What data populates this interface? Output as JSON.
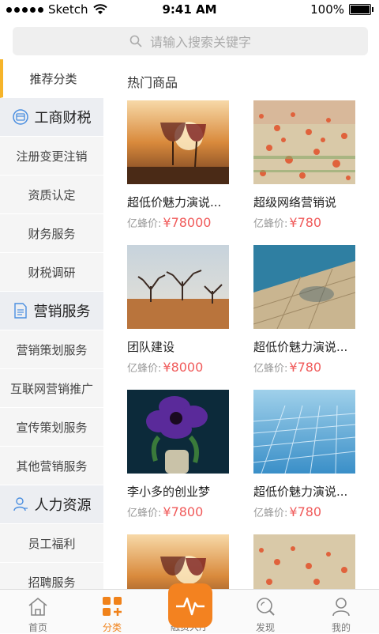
{
  "status_bar": {
    "carrier": "Sketch",
    "time": "9:41 AM",
    "battery": "100%"
  },
  "search": {
    "placeholder": "请输入搜索关键字"
  },
  "sidebar": {
    "recommend": "推荐分类",
    "groups": [
      {
        "title": "工商财税",
        "icon": "tax-icon",
        "items": [
          "注册变更注销",
          "资质认定",
          "财务服务",
          "财税调研"
        ]
      },
      {
        "title": "营销服务",
        "icon": "document-icon",
        "items": [
          "营销策划服务",
          "互联网营销推广",
          "宣传策划服务",
          "其他营销服务"
        ]
      },
      {
        "title": "人力资源",
        "icon": "person-icon",
        "items": [
          "员工福利",
          "招聘服务"
        ]
      }
    ]
  },
  "main": {
    "title": "热门商品",
    "price_label": "亿蜂价:",
    "products": [
      {
        "name": "超低价魅力演说...",
        "price": "¥78000",
        "image": "wine-glasses"
      },
      {
        "name": "超级网络营销说",
        "price": "¥780",
        "image": "flower-field"
      },
      {
        "name": "团队建设",
        "price": "¥8000",
        "image": "trees-landscape"
      },
      {
        "name": "超低价魅力演说...",
        "price": "¥780",
        "image": "water-pool"
      },
      {
        "name": "李小多的创业梦",
        "price": "¥7800",
        "image": "purple-flower"
      },
      {
        "name": "超低价魅力演说...",
        "price": "¥780",
        "image": "blue-tiles"
      },
      {
        "name": "",
        "price": "",
        "image": "wine-glasses"
      },
      {
        "name": "",
        "price": "",
        "image": "flower-field"
      }
    ]
  },
  "tabbar": {
    "home": "首页",
    "category": "分类",
    "finance": "融资大厅",
    "discover": "发现",
    "mine": "我的"
  },
  "colors": {
    "accent": "#f38220",
    "price": "#f05a5a",
    "active_bar": "#f6b42a"
  }
}
